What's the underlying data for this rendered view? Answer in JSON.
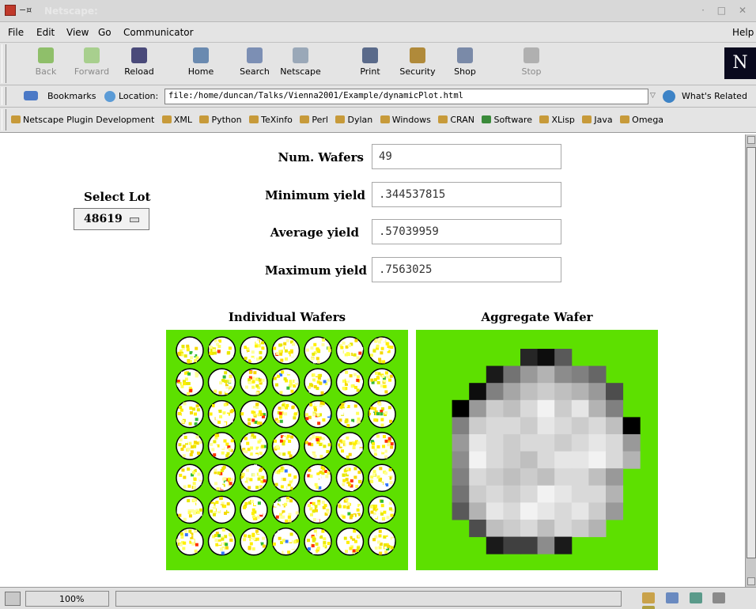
{
  "window": {
    "title": "Netscape:"
  },
  "menu": [
    "File",
    "Edit",
    "View",
    "Go",
    "Communicator",
    "Help"
  ],
  "nav_buttons": [
    {
      "label": "Back",
      "icon": "back-arrow-icon",
      "enabled": false
    },
    {
      "label": "Forward",
      "icon": "forward-arrow-icon",
      "enabled": false
    },
    {
      "label": "Reload",
      "icon": "reload-icon",
      "enabled": true
    },
    {
      "label": "Home",
      "icon": "home-icon",
      "enabled": true
    },
    {
      "label": "Search",
      "icon": "search-icon",
      "enabled": true
    },
    {
      "label": "Netscape",
      "icon": "netscape-icon",
      "enabled": true
    },
    {
      "label": "Print",
      "icon": "print-icon",
      "enabled": true
    },
    {
      "label": "Security",
      "icon": "lock-icon",
      "enabled": true
    },
    {
      "label": "Shop",
      "icon": "shop-icon",
      "enabled": true
    },
    {
      "label": "Stop",
      "icon": "stop-icon",
      "enabled": false
    }
  ],
  "location": {
    "bookmarks_label": "Bookmarks",
    "location_label": "Location:",
    "url": "file:/home/duncan/Talks/Vienna2001/Example/dynamicPlot.html",
    "related_label": "What's Related"
  },
  "personal_toolbar": [
    "Netscape Plugin Development",
    "XML",
    "Python",
    "TeXinfo",
    "Perl",
    "Dylan",
    "Windows",
    "CRAN",
    "Software",
    "XLisp",
    "Java",
    "Omega"
  ],
  "form": {
    "select_lot_label": "Select Lot",
    "lot_value": "48619",
    "num_wafers_label": "Num. Wafers",
    "num_wafers_value": "49",
    "min_yield_label": "Minimum yield",
    "min_yield_value": ".344537815",
    "avg_yield_label": "Average yield",
    "avg_yield_value": ".57039959",
    "max_yield_label": "Maximum yield",
    "max_yield_value": ".7563025"
  },
  "plots": {
    "individual_title": "Individual Wafers",
    "aggregate_title": "Aggregate Wafer",
    "background_color": "#5de000",
    "wafer_grid_rows": 7,
    "wafer_grid_cols": 7,
    "aggregate_gray_levels": [
      [
        null,
        null,
        null,
        null,
        null,
        0.15,
        0.05,
        0.35,
        null,
        null,
        null,
        null
      ],
      [
        null,
        null,
        null,
        0.1,
        0.45,
        0.6,
        0.7,
        0.55,
        0.5,
        0.4,
        null,
        null
      ],
      [
        null,
        null,
        0.05,
        0.5,
        0.65,
        0.75,
        0.8,
        0.75,
        0.7,
        0.6,
        0.3,
        null
      ],
      [
        null,
        0.0,
        0.6,
        0.8,
        0.75,
        0.85,
        0.95,
        0.8,
        0.9,
        0.7,
        0.5,
        null
      ],
      [
        null,
        0.5,
        0.8,
        0.85,
        0.85,
        0.8,
        0.9,
        0.85,
        0.8,
        0.85,
        0.75,
        0.0
      ],
      [
        null,
        0.6,
        0.9,
        0.85,
        0.8,
        0.85,
        0.85,
        0.8,
        0.85,
        0.9,
        0.85,
        0.6
      ],
      [
        null,
        0.55,
        0.95,
        0.85,
        0.8,
        0.75,
        0.85,
        0.9,
        0.9,
        0.95,
        0.85,
        0.7
      ],
      [
        null,
        0.5,
        0.85,
        0.8,
        0.75,
        0.8,
        0.75,
        0.85,
        0.85,
        0.75,
        0.6,
        null
      ],
      [
        null,
        0.45,
        0.8,
        0.85,
        0.8,
        0.85,
        0.95,
        0.9,
        0.85,
        0.85,
        0.7,
        null
      ],
      [
        null,
        0.35,
        0.7,
        0.9,
        0.85,
        0.95,
        0.9,
        0.85,
        0.9,
        0.8,
        0.6,
        null
      ],
      [
        null,
        null,
        0.3,
        0.75,
        0.8,
        0.85,
        0.75,
        0.85,
        0.8,
        0.7,
        null,
        null
      ],
      [
        null,
        null,
        null,
        0.1,
        0.25,
        0.25,
        0.55,
        0.1,
        null,
        null,
        null,
        null
      ]
    ]
  },
  "status": {
    "zoom": "100%"
  }
}
